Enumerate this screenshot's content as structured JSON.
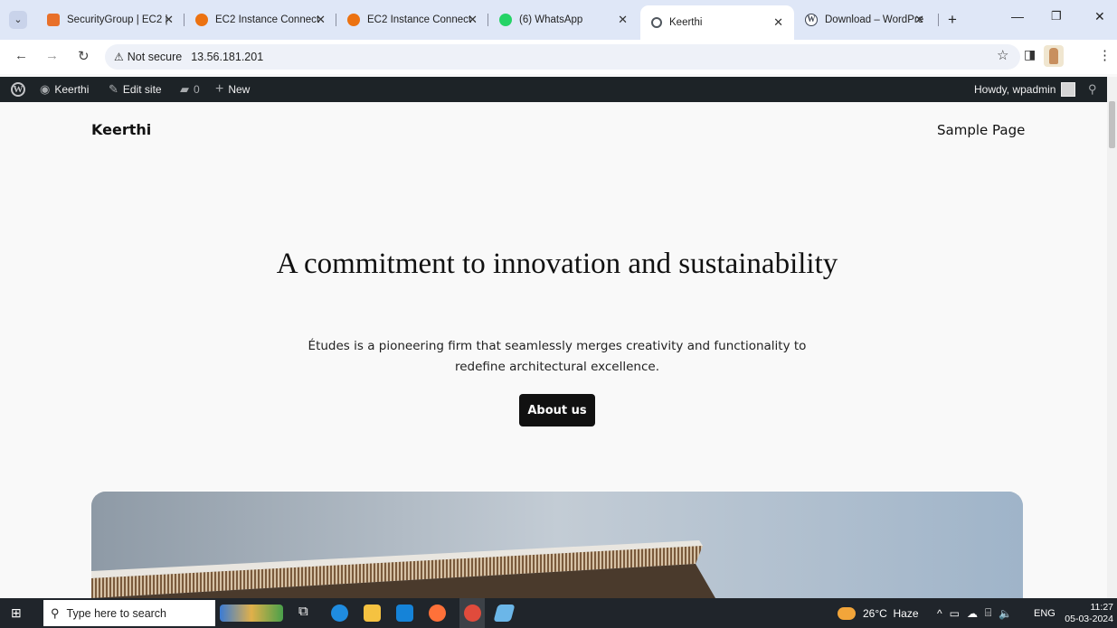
{
  "browser": {
    "tabs": [
      {
        "title": "SecurityGroup | EC2 |",
        "favicon_color": "#e8702a"
      },
      {
        "title": "EC2 Instance Connect",
        "favicon_color": "#ec7211"
      },
      {
        "title": "EC2 Instance Connect",
        "favicon_color": "#ec7211"
      },
      {
        "title": "(6) WhatsApp",
        "favicon_color": "#25d366"
      },
      {
        "title": "Keerthi",
        "favicon_color": "#50575e",
        "active": true
      },
      {
        "title": "Download – WordPre",
        "favicon_color": "#3858e9"
      }
    ],
    "new_tab": "+",
    "address": {
      "security": "Not secure",
      "url": "13.56.181.201"
    }
  },
  "admin_bar": {
    "site_name": "Keerthi",
    "edit_site": "Edit site",
    "comments_count": "0",
    "new_label": "New",
    "howdy": "Howdy, wpadmin"
  },
  "site": {
    "title": "Keerthi",
    "nav": [
      "Sample Page"
    ],
    "hero": {
      "heading": "A commitment to innovation and sustainability",
      "text": "Études is a pioneering firm that seamlessly merges creativity and functionality to redefine architectural excellence.",
      "button": "About us"
    }
  },
  "taskbar": {
    "search_placeholder": "Type here to search",
    "weather": "26°C  Haze",
    "language": "ENG",
    "time": "11:27",
    "date": "05-03-2024"
  },
  "colors": {
    "adminbar": "#1d2327",
    "tabstrip": "#dfe7f7",
    "button": "#111111"
  }
}
